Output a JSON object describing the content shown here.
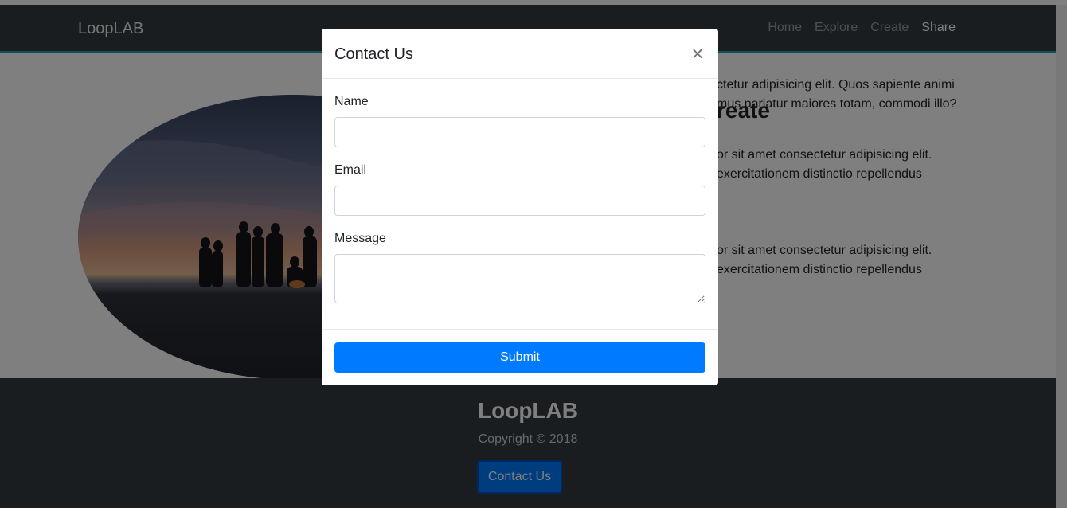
{
  "navbar": {
    "brand": "LoopLAB",
    "links": [
      {
        "label": "Home",
        "active": false
      },
      {
        "label": "Explore",
        "active": false
      },
      {
        "label": "Create",
        "active": false
      },
      {
        "label": "Share",
        "active": true
      }
    ]
  },
  "main": {
    "heading": "reate",
    "paragraphs": [
      {
        "lines": [
          "ctetur adipisicing elit. Quos sapiente animi",
          "mus pariatur maiores totam, commodi illo?"
        ]
      },
      {
        "lines": [
          "or sit amet consectetur adipisicing elit.",
          "exercitationem distinctio repellendus"
        ]
      },
      {
        "lines": [
          "or sit amet consectetur adipisicing elit.",
          "exercitationem distinctio repellendus"
        ]
      }
    ]
  },
  "footer": {
    "brand": "LoopLAB",
    "copyright": "Copyright © 2018",
    "contact_button": "Contact Us"
  },
  "modal": {
    "title": "Contact Us",
    "close_glyph": "×",
    "fields": {
      "name_label": "Name",
      "name_value": "",
      "email_label": "Email",
      "email_value": "",
      "message_label": "Message",
      "message_value": ""
    },
    "submit_label": "Submit"
  },
  "colors": {
    "navbar_bg": "#343a40",
    "primary": "#007bff",
    "backdrop": "rgba(0,0,0,0.5)"
  }
}
